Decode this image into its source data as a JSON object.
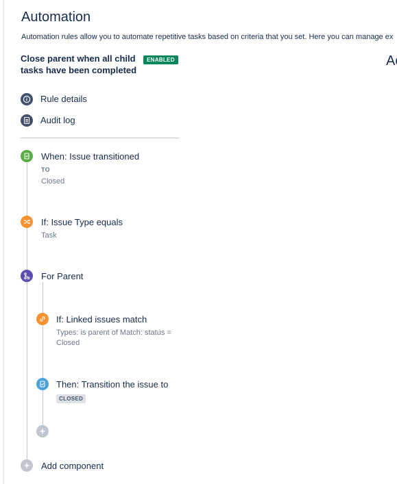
{
  "page": {
    "title": "Automation",
    "description": "Automation rules allow you to automate repetitive tasks based on criteria that you set. Here you can manage ex",
    "right_heading": "Ac"
  },
  "rule": {
    "name": "Close parent when all child tasks have been completed",
    "status_badge": "ENABLED"
  },
  "nav": {
    "rule_details": "Rule details",
    "audit_log": "Audit log"
  },
  "components": {
    "trigger": {
      "title": "When: Issue transitioned",
      "label": "TO",
      "value": "Closed",
      "icon": "trigger-icon",
      "color": "#5aac44"
    },
    "condition": {
      "title": "If: Issue Type equals",
      "value": "Task",
      "icon": "shuffle-icon",
      "color": "#f79232"
    },
    "branch": {
      "title": "For Parent",
      "icon": "branch-icon",
      "color": "#5e4db2"
    },
    "branch_condition": {
      "title": "If: Linked issues match",
      "value": "Types: is parent of Match: status = Closed",
      "icon": "link-icon",
      "color": "#f79232"
    },
    "branch_action": {
      "title": "Then: Transition the issue to",
      "lozenge": "CLOSED",
      "icon": "action-icon",
      "color": "#4ba1d8"
    }
  },
  "add_component": "Add component",
  "colors": {
    "enabled": "#00875a",
    "nav_icon": "#42526e",
    "connector": "#c1c7d0"
  }
}
